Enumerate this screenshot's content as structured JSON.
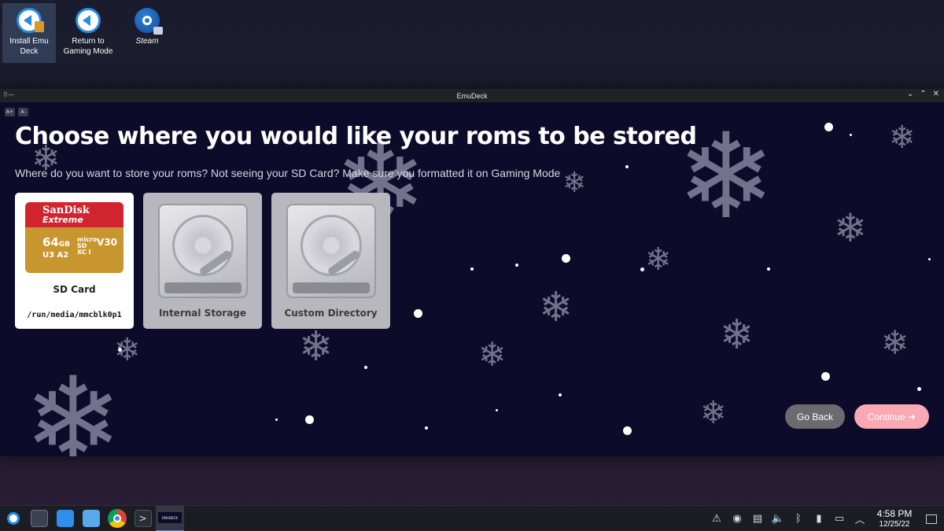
{
  "desktop": {
    "icons": [
      {
        "label": "Install Emu Deck",
        "icon": "emudeck-install-icon"
      },
      {
        "label": "Return to Gaming Mode",
        "icon": "gaming-mode-icon"
      },
      {
        "label": "Steam",
        "icon": "steam-icon"
      }
    ]
  },
  "window": {
    "title": "EmuDeck",
    "zoom_in": "A+",
    "zoom_out": "A-",
    "heading": "Choose where you would like your roms to be stored",
    "subtext": "Where do you want to store your roms? Not seeing your SD Card? Make sure you formatted it on Gaming Mode",
    "cards": [
      {
        "label": "SD Card",
        "path": "/run/media/mmcblk0p1",
        "selected": true
      },
      {
        "label": "Internal Storage",
        "selected": false
      },
      {
        "label": "Custom Directory",
        "selected": false
      }
    ],
    "sd_graphic": {
      "brand": "SanDisk",
      "line": "Extreme",
      "capacity": "64",
      "capacity_unit": "GB",
      "micro": "micro SD XC I",
      "speed": "V30",
      "tags": "U3 A2"
    },
    "buttons": {
      "back": "Go Back",
      "continue": "Continue ➔"
    }
  },
  "taskbar": {
    "apps": [
      "app-launcher-icon",
      "system-settings-icon",
      "discover-store-icon",
      "file-manager-icon",
      "chrome-icon",
      "konsole-icon",
      "emudeck-taskbar-icon"
    ],
    "active_app_label": "EMUDECK",
    "tray": [
      "notifications-icon",
      "steam-tray-icon",
      "clipboard-icon",
      "volume-icon",
      "bluetooth-icon",
      "usb-device-icon",
      "network-icon",
      "expand-tray-icon"
    ],
    "time": "4:58 PM",
    "date": "12/25/22"
  },
  "colors": {
    "window_bg": "#0c0b2a",
    "continue_button": "#f8a9b3",
    "back_button": "#6b6b6e",
    "taskbar_bg": "#1b1d25"
  }
}
